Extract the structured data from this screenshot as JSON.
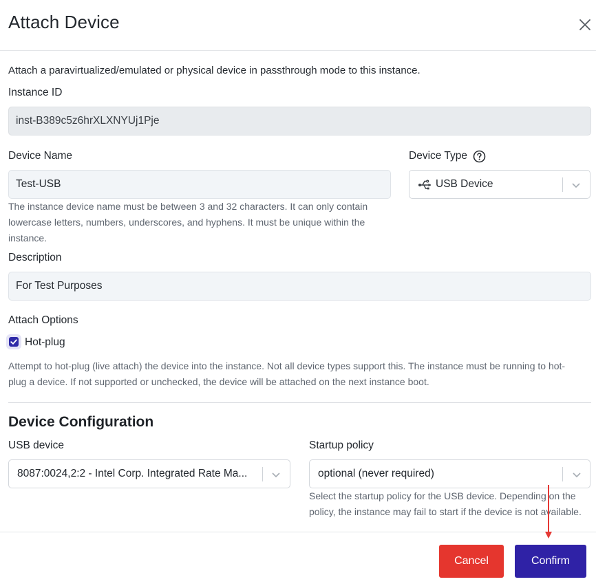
{
  "dialog": {
    "title": "Attach Device",
    "close_icon": "close-icon"
  },
  "intro": "Attach a paravirtualized/emulated or physical device in passthrough mode to this instance.",
  "instance_id": {
    "label": "Instance ID",
    "value": "inst-B389c5z6hrXLXNYUj1Pje"
  },
  "device_name": {
    "label": "Device Name",
    "value": "Test-USB",
    "help_line1": "The instance device name must be between 3 and 32 characters. It can only contain",
    "help_line2": "lowercase letters, numbers, underscores, and hyphens. It must be unique within the",
    "help_line3": "instance."
  },
  "device_type": {
    "label": "Device Type",
    "help_icon": "question-circle-icon",
    "value": "USB Device",
    "value_icon": "usb-icon"
  },
  "description": {
    "label": "Description",
    "value": "For Test Purposes"
  },
  "attach_options": {
    "label": "Attach Options",
    "hotplug_label": "Hot-plug",
    "hotplug_checked": true,
    "help_line1": "Attempt to hot-plug (live attach) the device into the instance. Not all device types support this. The instance must be running to hot-",
    "help_line2": "plug a device. If not supported or unchecked, the device will be attached on the next instance boot."
  },
  "device_configuration": {
    "title": "Device Configuration",
    "usb_device": {
      "label": "USB device",
      "value": "8087:0024,2:2 - Intel Corp. Integrated Rate Ma..."
    },
    "startup_policy": {
      "label": "Startup policy",
      "value": "optional (never required)",
      "help_line1": "Select the startup policy for the USB device. Depending on the",
      "help_line2": "policy, the instance may fail to start if the device is not available."
    }
  },
  "footer": {
    "cancel_label": "Cancel",
    "confirm_label": "Confirm"
  },
  "colors": {
    "cancel": "#e5362e",
    "confirm": "#2f22a6",
    "checkbox": "#2f2aa8",
    "annotation_arrow": "#e53935"
  }
}
